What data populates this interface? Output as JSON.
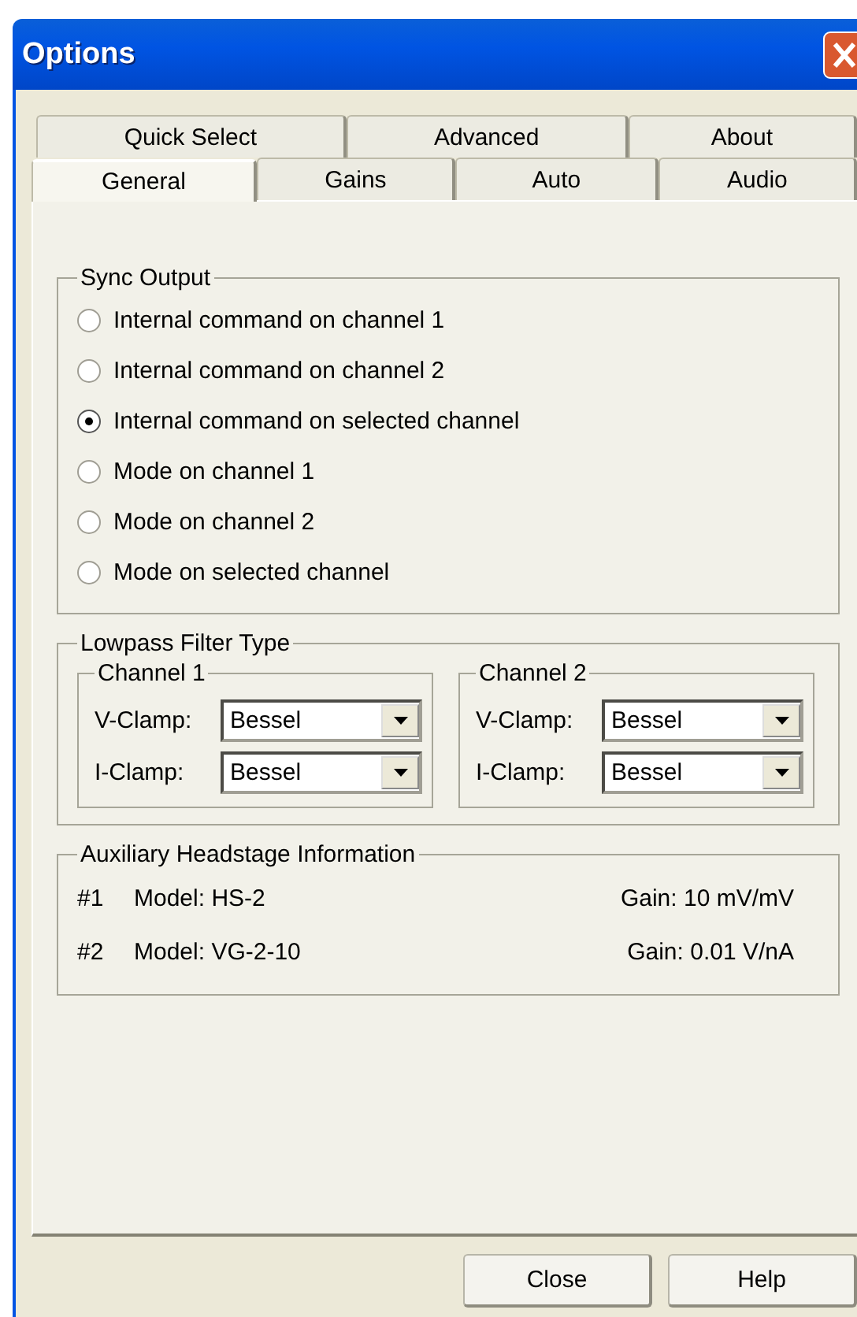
{
  "window": {
    "title": "Options"
  },
  "tab_rows": [
    [
      {
        "label": "Quick Select",
        "selected": false
      },
      {
        "label": "Advanced",
        "selected": false
      },
      {
        "label": "About",
        "selected": false
      }
    ],
    [
      {
        "label": "General",
        "selected": true
      },
      {
        "label": "Gains",
        "selected": false
      },
      {
        "label": "Auto",
        "selected": false
      },
      {
        "label": "Audio",
        "selected": false
      }
    ]
  ],
  "sync_output": {
    "title": "Sync Output",
    "options": [
      {
        "label": "Internal command on channel 1",
        "selected": false
      },
      {
        "label": "Internal command on channel 2",
        "selected": false
      },
      {
        "label": "Internal command on selected channel",
        "selected": true
      },
      {
        "label": "Mode on channel 1",
        "selected": false
      },
      {
        "label": "Mode on channel 2",
        "selected": false
      },
      {
        "label": "Mode on selected channel",
        "selected": false
      }
    ]
  },
  "lowpass": {
    "title": "Lowpass Filter Type",
    "channels": [
      {
        "title": "Channel 1",
        "rows": [
          {
            "label": "V-Clamp:",
            "value": "Bessel"
          },
          {
            "label": "I-Clamp:",
            "value": "Bessel"
          }
        ]
      },
      {
        "title": "Channel 2",
        "rows": [
          {
            "label": "V-Clamp:",
            "value": "Bessel"
          },
          {
            "label": "I-Clamp:",
            "value": "Bessel"
          }
        ]
      }
    ]
  },
  "aux": {
    "title": "Auxiliary Headstage Information",
    "rows": [
      {
        "number": "#1",
        "model": "Model: HS-2",
        "gain": "Gain: 10 mV/mV"
      },
      {
        "number": "#2",
        "model": "Model: VG-2-10",
        "gain": "Gain: 0.01 V/nA"
      }
    ]
  },
  "buttons": [
    "Close",
    "Help"
  ]
}
